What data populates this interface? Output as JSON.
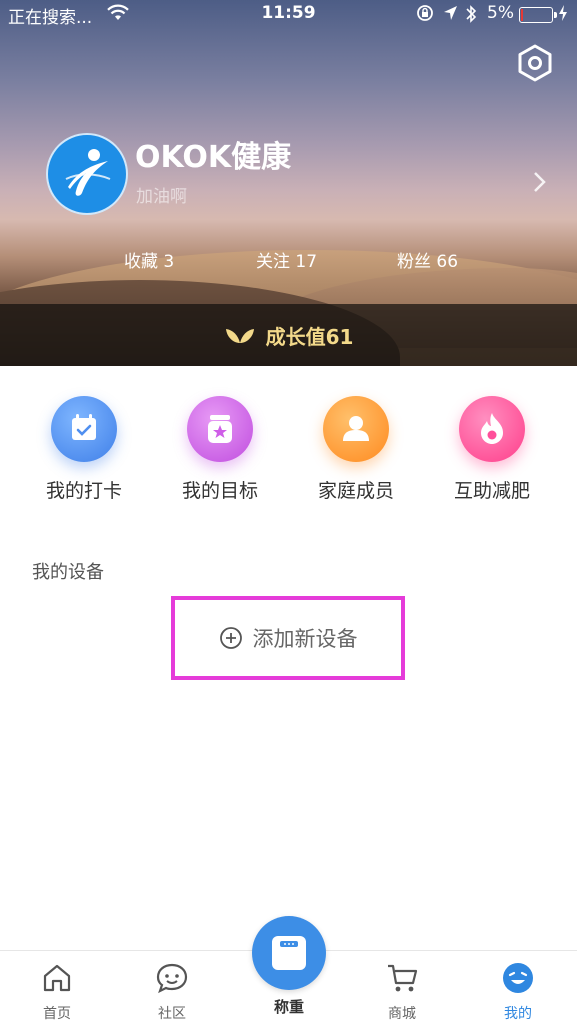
{
  "status_bar": {
    "carrier": "正在搜索...",
    "time": "11:59",
    "battery": "5%",
    "battery_level": 0.05
  },
  "profile": {
    "name": "OKOK健康",
    "motto": "加油啊"
  },
  "stats": [
    {
      "label": "收藏 3"
    },
    {
      "label": "关注 17"
    },
    {
      "label": "粉丝 66"
    }
  ],
  "growth": {
    "label": "成长值61"
  },
  "shortcuts": [
    {
      "label": "我的打卡",
      "icon": "calendar-check-icon",
      "color": "#4f8ff0"
    },
    {
      "label": "我的目标",
      "icon": "target-star-icon",
      "color": "#cf5ee8"
    },
    {
      "label": "家庭成员",
      "icon": "family-member-icon",
      "color": "#ff9a2e"
    },
    {
      "label": "互助减肥",
      "icon": "flame-icon",
      "color": "#ff4f9a"
    }
  ],
  "devices": {
    "title": "我的设备",
    "add_label": "添加新设备"
  },
  "tabs": [
    {
      "label": "首页",
      "icon": "home-icon"
    },
    {
      "label": "社区",
      "icon": "chat-bubble-icon"
    },
    {
      "label": "称重",
      "icon": "scale-icon"
    },
    {
      "label": "商城",
      "icon": "cart-icon"
    },
    {
      "label": "我的",
      "icon": "smile-icon"
    }
  ],
  "colors": {
    "accent": "#2f87e0",
    "highlight_border": "#e53bd9",
    "growth_text": "#f3d98a"
  }
}
